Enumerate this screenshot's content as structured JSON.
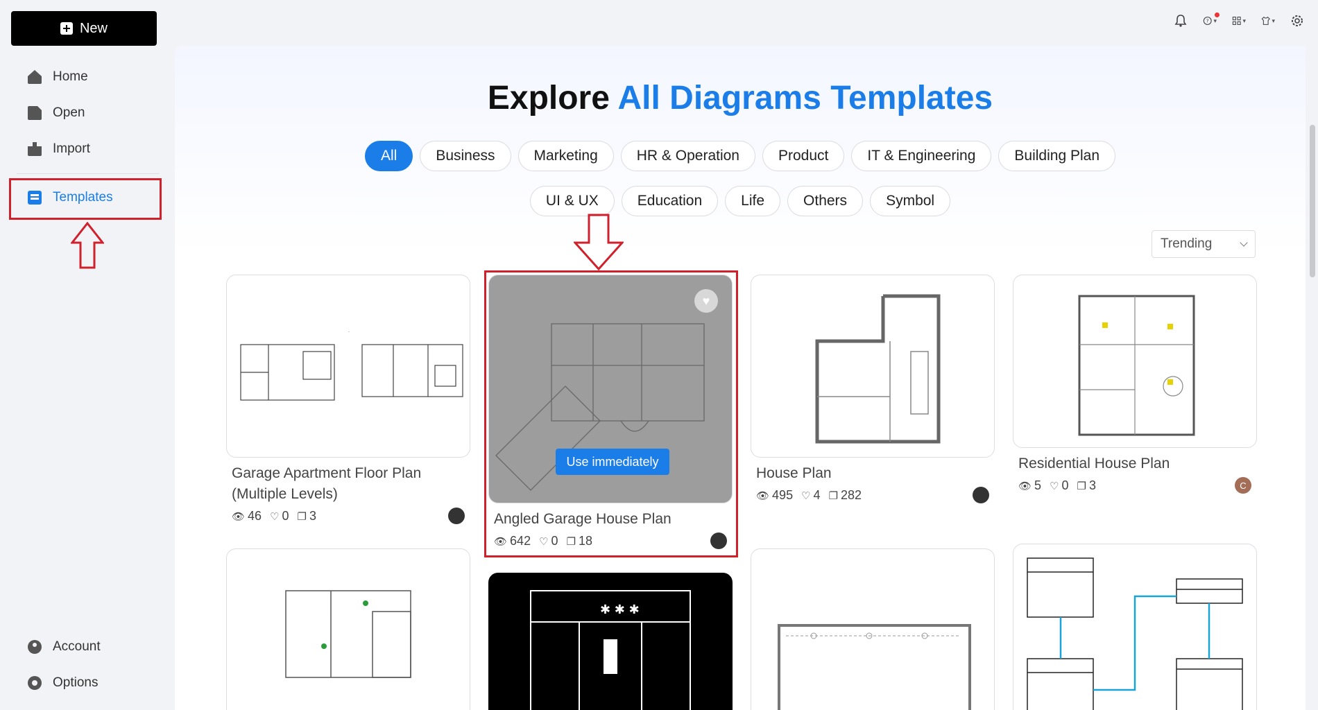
{
  "sidebar": {
    "new_label": "New",
    "items": [
      {
        "label": "Home",
        "icon": "home-icon"
      },
      {
        "label": "Open",
        "icon": "file-icon"
      },
      {
        "label": "Import",
        "icon": "import-icon"
      },
      {
        "label": "Templates",
        "icon": "templates-icon"
      }
    ],
    "bottom": [
      {
        "label": "Account",
        "icon": "account-icon"
      },
      {
        "label": "Options",
        "icon": "gear-icon"
      }
    ]
  },
  "topbar": {
    "icons": [
      "bell-icon",
      "help-icon",
      "apps-icon",
      "shirt-icon",
      "settings-icon"
    ]
  },
  "hero": {
    "title_part1": "Explore",
    "title_part2": "All Diagrams Templates"
  },
  "categories_row1": [
    "All",
    "Business",
    "Marketing",
    "HR & Operation",
    "Product",
    "IT & Engineering",
    "Building Plan"
  ],
  "categories_row2": [
    "UI & UX",
    "Education",
    "Life",
    "Others",
    "Symbol"
  ],
  "sort": {
    "selected": "Trending"
  },
  "cards": [
    {
      "title": "Garage Apartment Floor Plan (Multiple Levels)",
      "views": "46",
      "likes": "0",
      "copies": "3"
    },
    {
      "title": "Angled Garage House Plan",
      "views": "642",
      "likes": "0",
      "copies": "18",
      "use_label": "Use immediately"
    },
    {
      "title": "House Plan",
      "views": "495",
      "likes": "4",
      "copies": "282"
    },
    {
      "title": "Residential House Plan",
      "views": "5",
      "likes": "0",
      "copies": "3",
      "avatar_letter": "C"
    }
  ],
  "colors": {
    "accent": "#1a7de8",
    "highlight": "#d0202c"
  }
}
